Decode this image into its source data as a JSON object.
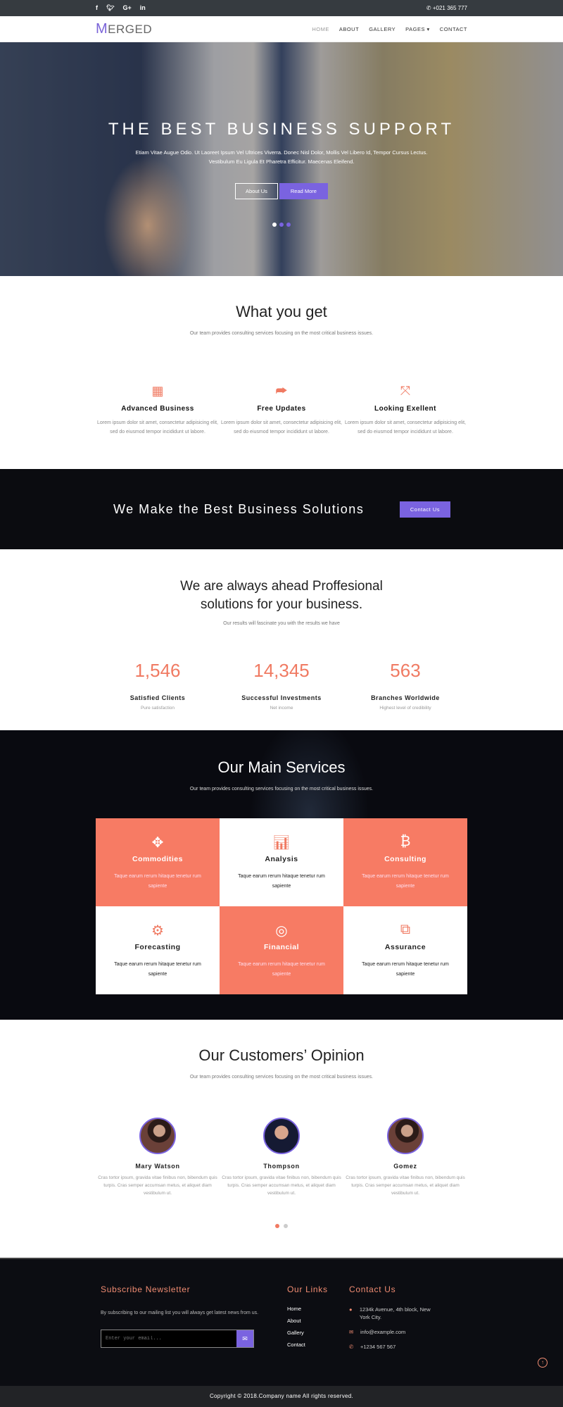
{
  "topbar": {
    "social": [
      "f",
      "t",
      "G+",
      "in"
    ],
    "social_icons": [
      "facebook-icon",
      "twitter-icon",
      "google-plus-icon",
      "linkedin-icon"
    ],
    "phone": "+021 365 777"
  },
  "nav": {
    "logo_initial": "M",
    "logo_rest": "ERGED",
    "menu": [
      "HOME",
      "ABOUT",
      "GALLERY",
      "PAGES ▾",
      "CONTACT"
    ]
  },
  "hero": {
    "title": "THE BEST BUSINESS SUPPORT",
    "text": "Etiam Vitae Augue Odio. Ut Laoreet Ipsum Vel Ultrices Viverra. Donec Nisl Dolor, Mollis Vel Libero Id, Tempor Cursus Lectus. Vestibulum Eu Ligula Et Pharetra Efficitur. Maecenas Eleifend.",
    "btn1": "About Us",
    "btn2": "Read More",
    "slides": 3,
    "active_slide": 1
  },
  "what": {
    "title": "What you get",
    "sub": "Our team provides consulting services focusing on the most critical business issues.",
    "features": [
      {
        "icon": "grid-icon",
        "title": "Advanced Business",
        "text": "Lorem ipsum dolor sit amet, consectetur adipisicing elit, sed do eiusmod tempor incididunt ut labore."
      },
      {
        "icon": "share-icon",
        "title": "Free Updates",
        "text": "Lorem ipsum dolor sit amet, consectetur adipisicing elit, sed do eiusmod tempor incididunt ut labore."
      },
      {
        "icon": "expand-icon",
        "title": "Looking Exellent",
        "text": "Lorem ipsum dolor sit amet, consectetur adipisicing elit, sed do eiusmod tempor incididunt ut labore."
      }
    ]
  },
  "band": {
    "title": "We Make the Best Business Solutions",
    "button": "Contact Us"
  },
  "stats": {
    "title1": "We are always ahead Proffesional",
    "title2": "solutions for your business.",
    "sub": "Our results will fascinate you with the results we have",
    "items": [
      {
        "num": "1,546",
        "label": "Satisfied Clients",
        "sub": "Pure satisfaction"
      },
      {
        "num": "14,345",
        "label": "Successful Investments",
        "sub": "Net income"
      },
      {
        "num": "563",
        "label": "Branches Worldwide",
        "sub": "Highest level of credibility"
      }
    ]
  },
  "services": {
    "title": "Our Main Services",
    "sub": "Our team provides consulting services focusing on the most critical business issues.",
    "items": [
      {
        "icon": "arrows-move-icon",
        "title": "Commodities",
        "text": "Taque earum rerum hitaque tenetur rum sapiente"
      },
      {
        "icon": "bar-chart-icon",
        "title": "Analysis",
        "text": "Taque earum rerum hitaque tenetur rum sapiente"
      },
      {
        "icon": "bitcoin-icon",
        "title": "Consulting",
        "text": "Taque earum rerum hitaque tenetur rum sapiente"
      },
      {
        "icon": "gears-icon",
        "title": "Forecasting",
        "text": "Taque earum rerum hitaque tenetur rum sapiente"
      },
      {
        "icon": "target-icon",
        "title": "Financial",
        "text": "Taque earum rerum hitaque tenetur rum sapiente"
      },
      {
        "icon": "cubes-icon",
        "title": "Assurance",
        "text": "Taque earum rerum hitaque tenetur rum sapiente"
      }
    ]
  },
  "customers": {
    "title": "Our Customers’ Opinion",
    "sub": "Our team provides consulting services focusing on the most critical business issues.",
    "items": [
      {
        "name": "Mary Watson",
        "text": "Cras tortor ipsum, gravida vitae finibus non, bibendum quis turpis. Cras semper accumsan metus, et aliquet diam vestibulum ut."
      },
      {
        "name": "Thompson",
        "text": "Cras tortor ipsum, gravida vitae finibus non, bibendum quis turpis. Cras semper accumsan metus, et aliquet diam vestibulum ut."
      },
      {
        "name": "Gomez",
        "text": "Cras tortor ipsum, gravida vitae finibus non, bibendum quis turpis. Cras semper accumsan metus, et aliquet diam vestibulum ut."
      }
    ]
  },
  "footer": {
    "subscribe_title": "Subscribe Newsletter",
    "subscribe_text": "By subscribing to our mailing list you will always get latest news from us.",
    "email_placeholder": "Enter your email...",
    "links_title": "Our Links",
    "links": [
      "Home",
      "About",
      "Gallery",
      "Contact"
    ],
    "contact_title": "Contact Us",
    "address": "1234k Avenue, 4th block, New York City.",
    "email": "info@example.com",
    "phone": "+1234 567 567",
    "copyright": "Copyright © 2018.Company name All rights reserved."
  },
  "colors": {
    "accent": "#7a63e0",
    "coral": "#f77b64",
    "dark": "#0b0c10",
    "topbar": "#363b40"
  }
}
